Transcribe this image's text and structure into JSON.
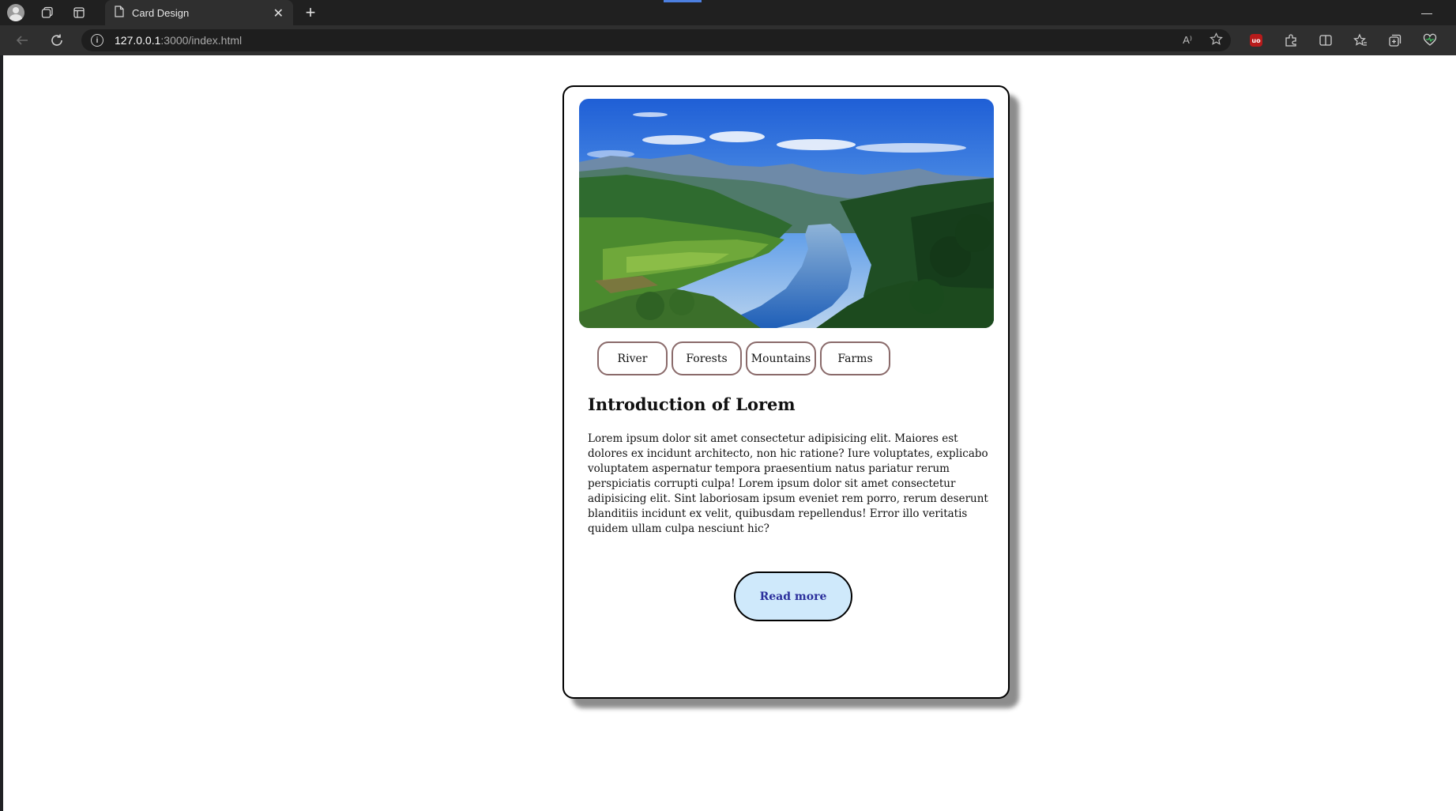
{
  "browser": {
    "tab_title": "Card Design",
    "url_host": "127.0.0.1",
    "url_rest": ":3000/index.html",
    "read_aloud_label": "A⁾"
  },
  "card": {
    "image_alt": "River valley landscape",
    "tags": [
      "River",
      "Forests",
      "Mountains",
      "Farms"
    ],
    "title": "Introduction of Lorem",
    "body": "Lorem ipsum dolor sit amet consectetur adipisicing elit. Maiores est dolores ex incidunt architecto, non hic ratione? Iure voluptates, explicabo voluptatem aspernatur tempora praesentium natus pariatur rerum perspiciatis corrupti culpa! Lorem ipsum dolor sit amet consectetur adipisicing elit. Sint laboriosam ipsum eveniet rem porro, rerum deserunt blanditiis incidunt ex velit, quibusdam repellendus! Error illo veritatis quidem ullam culpa nesciunt hic?",
    "button_label": "Read more"
  },
  "colors": {
    "button_bg": "#cfe9fb",
    "button_text": "#2b2f9c",
    "tag_border": "#8a6a6a"
  }
}
